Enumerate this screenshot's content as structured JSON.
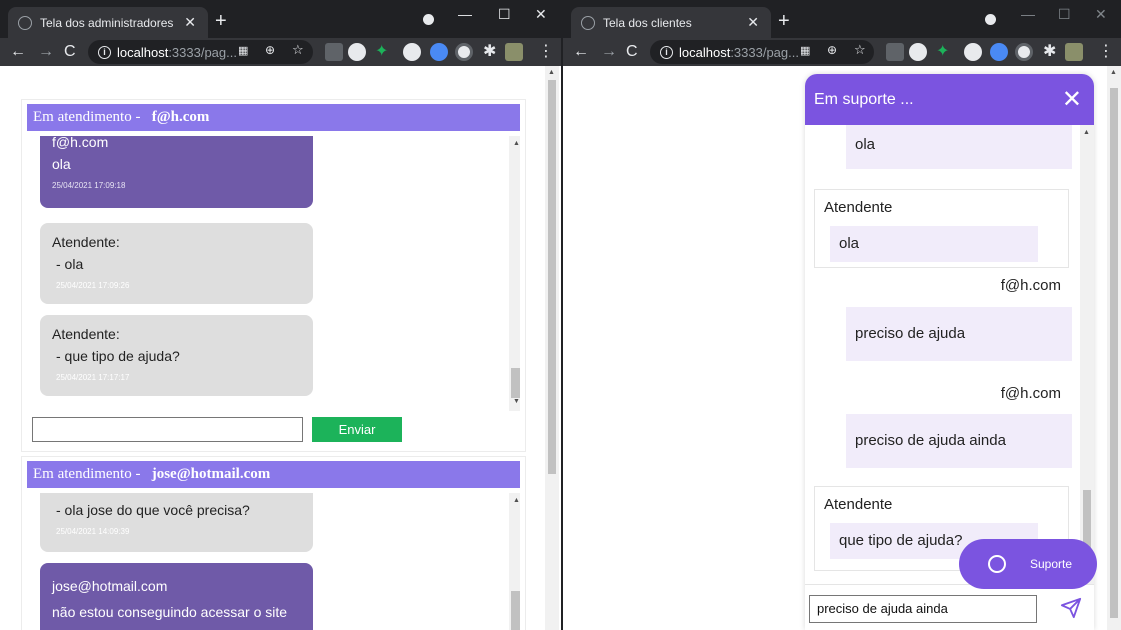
{
  "left_window": {
    "tab_title": "Tela dos administradores",
    "url_host": "localhost",
    "url_rest": ":3333/pag...",
    "panels": [
      {
        "header_prefix": "Em atendimento -",
        "header_user": "f@h.com",
        "messages": [
          {
            "type": "client",
            "author": "f@h.com",
            "text": "ola",
            "time": "25/04/2021 17:09:18"
          },
          {
            "type": "admin",
            "author": "Atendente:",
            "text": "- ola",
            "time": "25/04/2021 17:09:26"
          },
          {
            "type": "admin",
            "author": "Atendente:",
            "text": "- que tipo de ajuda?",
            "time": "25/04/2021 17:17:17"
          }
        ],
        "input_value": "",
        "send_label": "Enviar"
      },
      {
        "header_prefix": "Em atendimento -",
        "header_user": "jose@hotmail.com",
        "messages": [
          {
            "type": "admin",
            "text": "- ola jose do que você precisa?",
            "time": "25/04/2021 14:09:39"
          },
          {
            "type": "client",
            "author": "jose@hotmail.com",
            "text": "não estou conseguindo acessar o site"
          }
        ]
      }
    ]
  },
  "right_window": {
    "tab_title": "Tela dos clientes",
    "url_host": "localhost",
    "url_rest": ":3333/pag...",
    "widget": {
      "title": "Em suporte ...",
      "messages": [
        {
          "type": "user",
          "text": "ola"
        },
        {
          "type": "attendant",
          "name": "Atendente",
          "text": "ola"
        },
        {
          "type": "user",
          "name": "f@h.com",
          "text": "preciso de ajuda"
        },
        {
          "type": "user",
          "name": "f@h.com",
          "text": "preciso de ajuda ainda"
        },
        {
          "type": "attendant",
          "name": "Atendente",
          "text": "que tipo de ajuda?"
        }
      ],
      "input_value": "preciso de ajuda ainda"
    },
    "support_button_label": "Suporte"
  },
  "colors": {
    "panel_header": "#8a78ea",
    "client_bubble": "#6f5aa8",
    "admin_bubble": "#dedede",
    "send_button": "#1cb35a",
    "widget_accent": "#7b54e0",
    "user_bubble": "#f1ecfa"
  }
}
